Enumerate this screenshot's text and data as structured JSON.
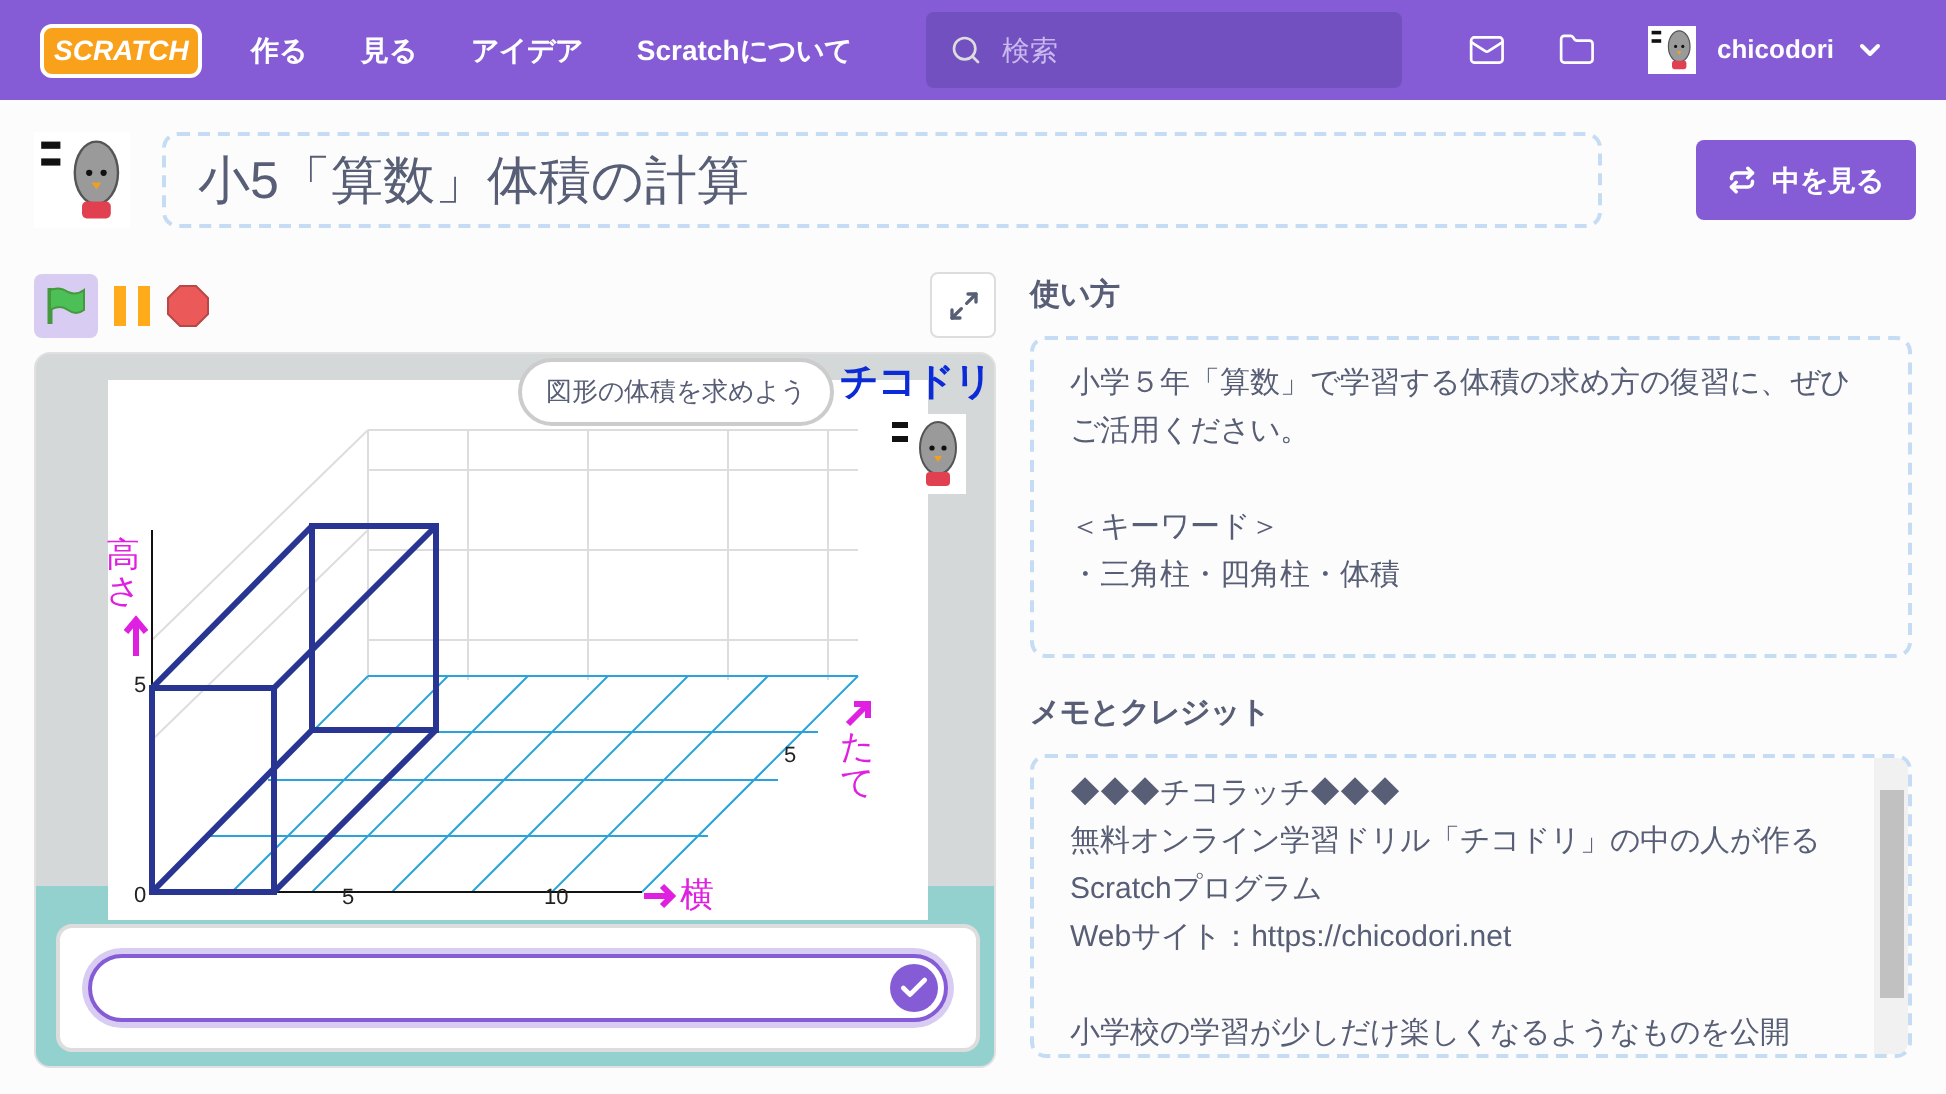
{
  "nav": {
    "logo": "SCRATCH",
    "items": [
      "作る",
      "見る",
      "アイデア",
      "Scratchについて"
    ],
    "search": {
      "placeholder": "検索"
    },
    "username": "chicodori"
  },
  "project": {
    "title": "小5「算数」体積の計算",
    "see_inside": "中を見る"
  },
  "controls": {
    "running": true
  },
  "stage": {
    "bubble": "図形の体積を求めよう",
    "logo": "チコドリ",
    "height_label": "高さ",
    "depth_label": "たて",
    "width_label": "横",
    "y_ticks": [
      "5",
      "0"
    ],
    "x_ticks": [
      "5",
      "10"
    ],
    "depth_ticks": [
      "5"
    ]
  },
  "instructions": {
    "heading": "使い方",
    "paragraphs": [
      [
        "小学５年「算数」で学習する体積の求め方の復習に、ぜひご活用ください。"
      ],
      [
        "＜キーワード＞",
        "・三角柱・四角柱・体積"
      ]
    ]
  },
  "notes": {
    "heading": "メモとクレジット",
    "paragraphs": [
      [
        "◆◆◆チコラッチ◆◆◆",
        "無料オンライン学習ドリル「チコドリ」の中の人が作るScratchプログラム",
        "Webサイト：https://chicodori.net"
      ],
      [
        "小学校の学習が少しだけ楽しくなるようなものを公開"
      ]
    ]
  }
}
